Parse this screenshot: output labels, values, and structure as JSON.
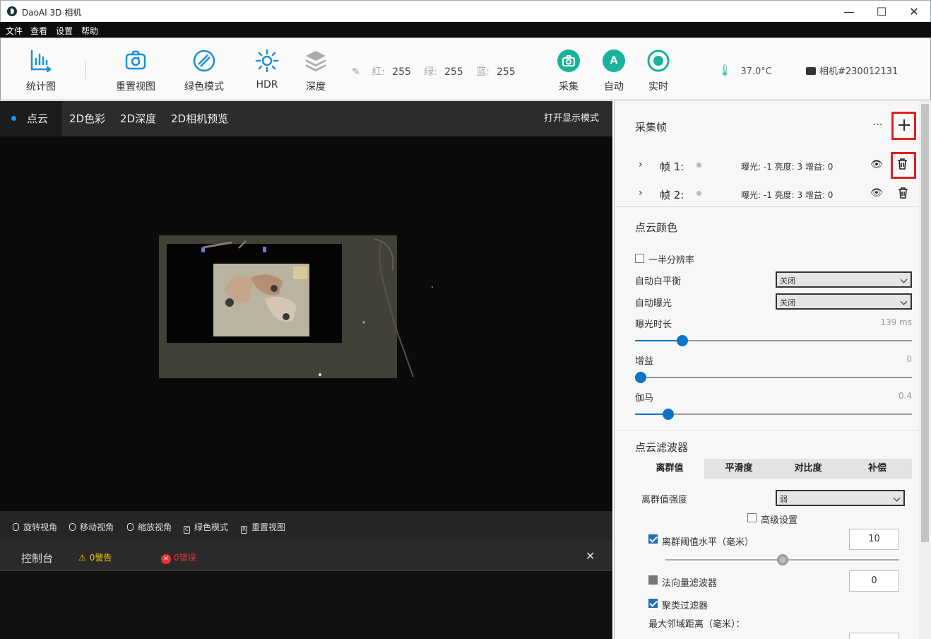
{
  "window": {
    "title": "DaoAI 3D 相机",
    "minimize": "—",
    "maximize": "☐",
    "close": "✕"
  },
  "menu": [
    "文件",
    "查看",
    "设置",
    "帮助"
  ],
  "toolbar": {
    "stats": "统计图",
    "reset_view": "重置视图",
    "green_mode": "绿色模式",
    "hdr": "HDR",
    "depth": "深度",
    "rgb": {
      "r_label": "红:",
      "r": "255",
      "g_label": "绿:",
      "g": "255",
      "b_label": "蓝:",
      "b": "255"
    },
    "capture": "采集",
    "auto": "自动",
    "auto_icon_text": "A",
    "live": "实时",
    "temperature": "37.0°C",
    "camera": "相机#230012131"
  },
  "viewer": {
    "tabs": [
      "点云",
      "2D色彩",
      "2D深度",
      "2D相机预览"
    ],
    "open_display_mode": "打开显示模式",
    "hints": [
      {
        "key": "",
        "label": "旋转视角"
      },
      {
        "key": "",
        "label": "移动视角"
      },
      {
        "key": "",
        "label": "缩放视角"
      },
      {
        "key": "C",
        "label": "绿色模式"
      },
      {
        "key": "R",
        "label": "重置视图"
      }
    ],
    "console": {
      "title": "控制台",
      "warnings": "0警告",
      "errors": "0错误",
      "close": "✕"
    }
  },
  "panel": {
    "frames_title": "采集帧",
    "more": "···",
    "add": "+",
    "frames": [
      {
        "expand": "›",
        "name": "帧 1:",
        "info": "曝光: -1  亮度: 3  增益: 0"
      },
      {
        "expand": "›",
        "name": "帧 2:",
        "info": "曝光: -1  亮度: 3  增益: 0"
      }
    ],
    "color_title": "点云颜色",
    "half_res": "一半分辨率",
    "auto_wb": {
      "label": "自动白平衡",
      "value": "关闭"
    },
    "auto_exp": {
      "label": "自动曝光",
      "value": "关闭"
    },
    "exposure": {
      "label": "曝光时长",
      "value": "139 ms",
      "level": 0.17
    },
    "gain": {
      "label": "增益",
      "value": "0",
      "level": 0.0
    },
    "gamma": {
      "label": "伽马",
      "value": "0.4",
      "level": 0.12
    },
    "filter_title": "点云滤波器",
    "filter_tabs": [
      "离群值",
      "平滑度",
      "对比度",
      "补偿"
    ],
    "outlier_strength": {
      "label": "离群值强度",
      "value": "弱"
    },
    "advanced": "高级设置",
    "outlier_threshold": {
      "label": "离群阈值水平（毫米）",
      "value": "10",
      "level": 0.5
    },
    "normal_filter": {
      "label": "法向量滤波器",
      "value": "0"
    },
    "cluster_filter": "聚类过滤器",
    "max_neighbor": "最大邻域距离（毫米）："
  }
}
